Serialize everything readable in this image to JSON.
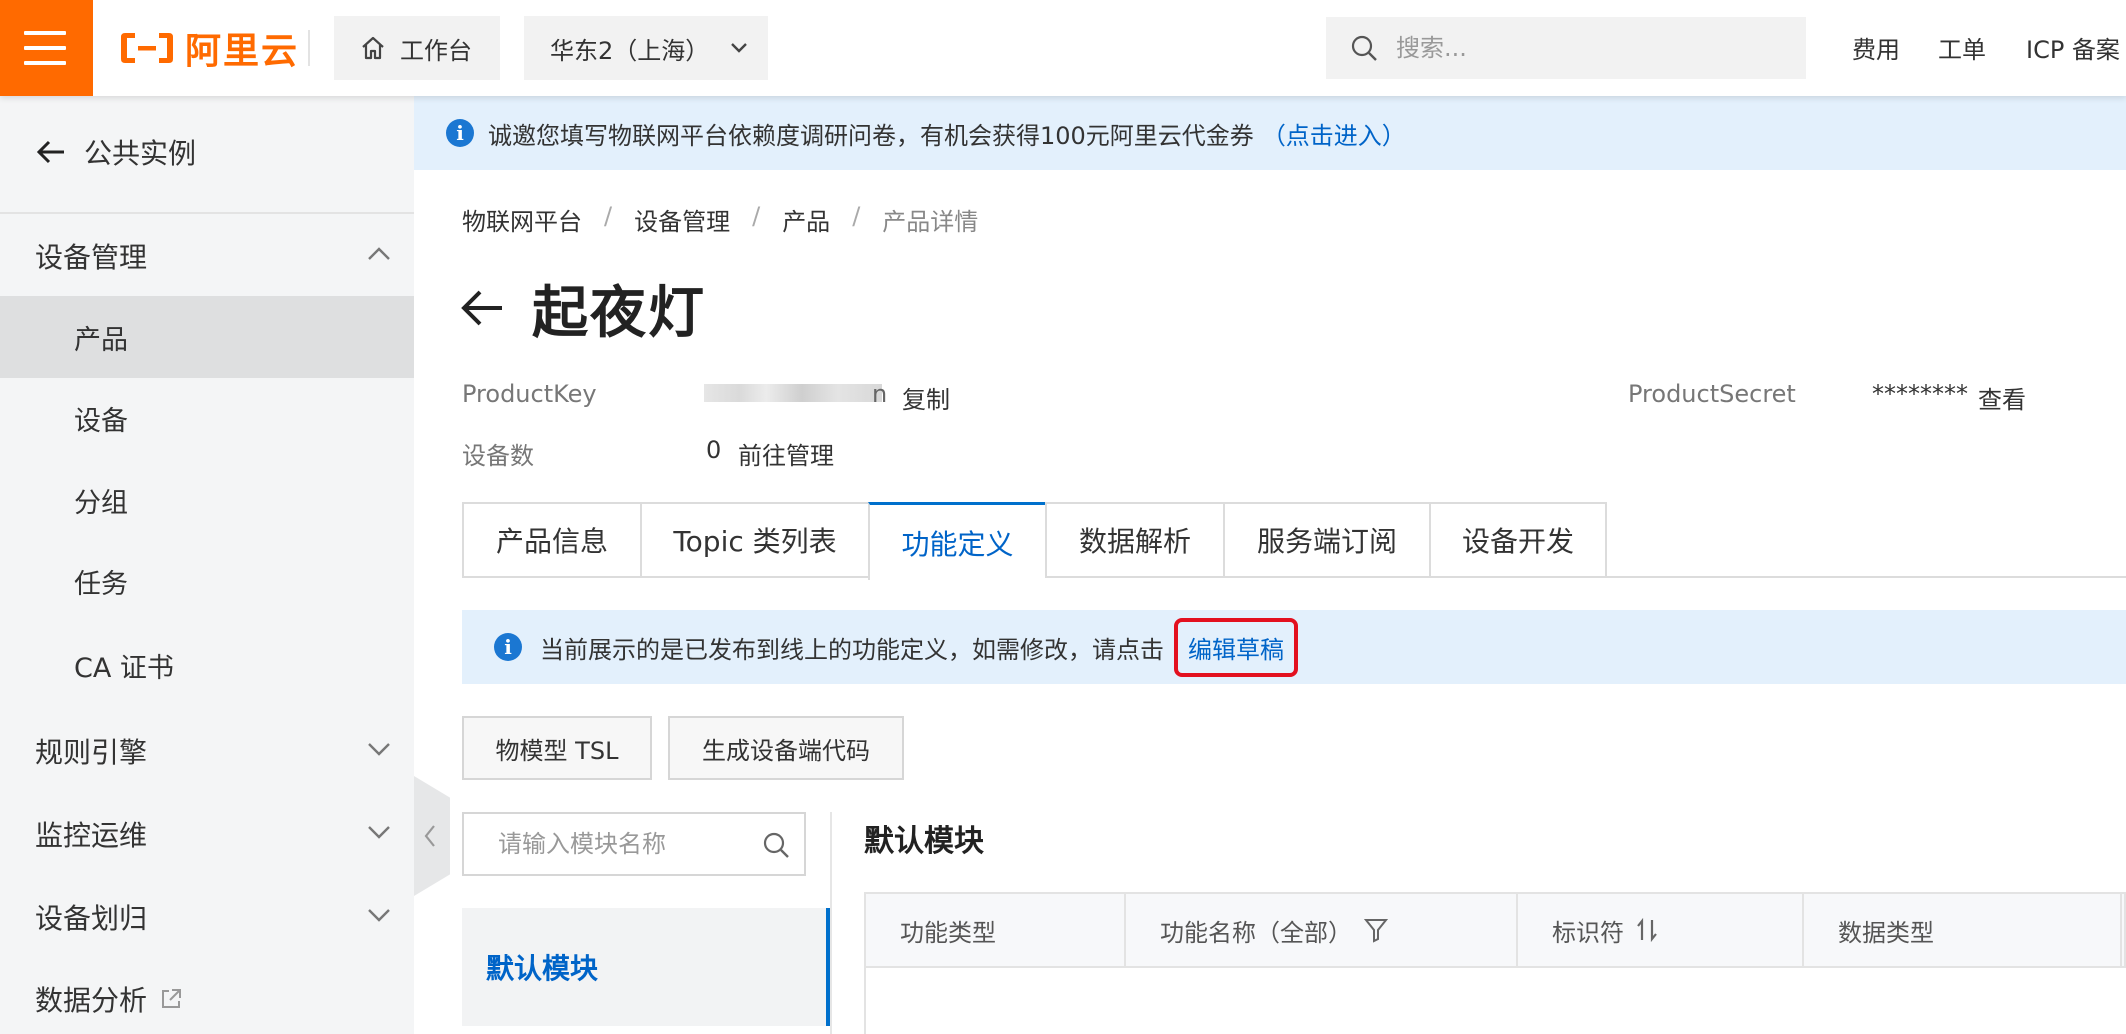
{
  "topbar": {
    "logo_text": "阿里云",
    "workbench": "工作台",
    "region": "华东2（上海）",
    "search_placeholder": "搜索...",
    "links": [
      "费用",
      "工单",
      "ICP 备案"
    ]
  },
  "sidebar": {
    "back_label": "公共实例",
    "groups": [
      {
        "label": "设备管理",
        "expanded": true
      },
      {
        "label": "规则引擎",
        "expanded": false
      },
      {
        "label": "监控运维",
        "expanded": false
      },
      {
        "label": "设备划归",
        "expanded": false
      },
      {
        "label": "数据分析",
        "external": true
      }
    ],
    "items": [
      "产品",
      "设备",
      "分组",
      "任务",
      "CA 证书"
    ],
    "active_item": "产品"
  },
  "notice": {
    "text": "诚邀您填写物联网平台依赖度调研问卷，有机会获得100元阿里云代金券",
    "link": "（点击进入）"
  },
  "breadcrumb": [
    "物联网平台",
    "设备管理",
    "产品",
    "产品详情"
  ],
  "page_title": "起夜灯",
  "meta": {
    "product_key_label": "ProductKey",
    "product_key_suffix": "n",
    "copy_link": "复制",
    "product_secret_label": "ProductSecret",
    "product_secret_value": "********",
    "view_link": "查看",
    "device_count_label": "设备数",
    "device_count_value": "0",
    "manage_link": "前往管理"
  },
  "tabs": [
    "产品信息",
    "Topic 类列表",
    "功能定义",
    "数据解析",
    "服务端订阅",
    "设备开发"
  ],
  "active_tab": "功能定义",
  "func_notice": {
    "text": "当前展示的是已发布到线上的功能定义，如需修改，请点击",
    "link": "编辑草稿"
  },
  "buttons": {
    "tsl": "物模型 TSL",
    "gen_code": "生成设备端代码"
  },
  "module_search_placeholder": "请输入模块名称",
  "module_item": "默认模块",
  "section_title": "默认模块",
  "table": {
    "columns": [
      "功能类型",
      "功能名称（全部）",
      "标识符",
      "数据类型"
    ]
  },
  "colors": {
    "brand_orange": "#ff6a00",
    "link_blue": "#0064c8",
    "highlight_red": "#e3101f"
  }
}
